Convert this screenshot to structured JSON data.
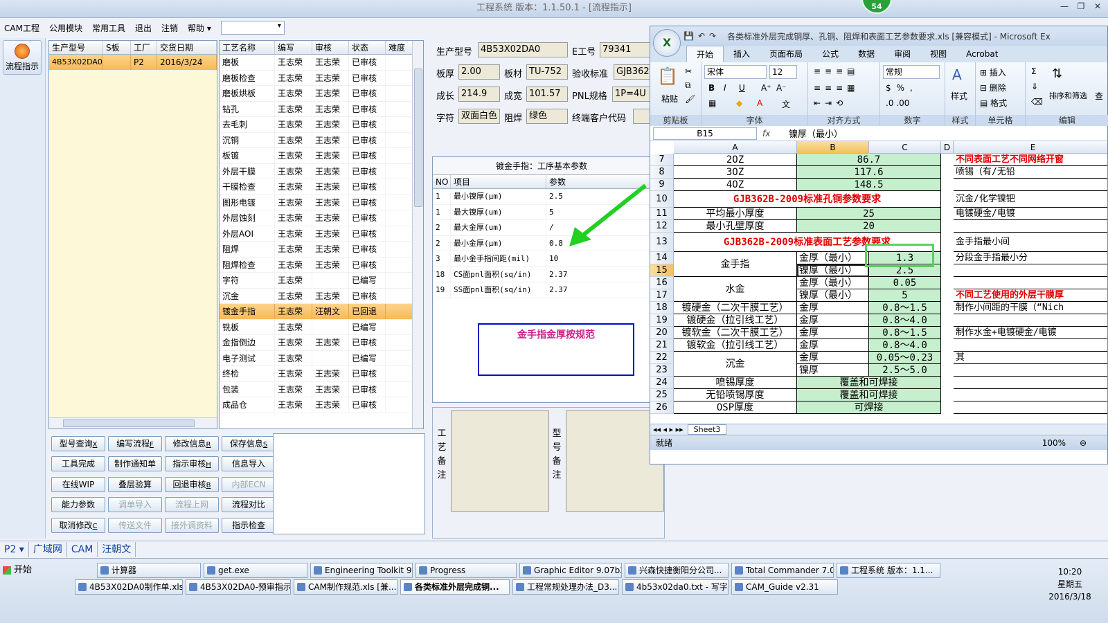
{
  "app": {
    "title": "工程系统  版本：1.1.50.1 - [流程指示]",
    "badge": "54"
  },
  "menu": [
    "CAM工程",
    "公用模块",
    "常用工具",
    "退出",
    "注销",
    "帮助"
  ],
  "nav": {
    "flow_label": "流程指示"
  },
  "product_grid": {
    "headers": [
      "生产型号",
      "S板",
      "工厂",
      "交货日期"
    ],
    "rows": [
      [
        "4B53X02DA0",
        "",
        "P2",
        "2016/3/24"
      ]
    ]
  },
  "process_grid": {
    "headers": [
      "工艺名称",
      "编写",
      "审核",
      "状态",
      "难度"
    ],
    "rows": [
      [
        "磨板",
        "王志荣",
        "王志荣",
        "已审核"
      ],
      [
        "磨板检查",
        "王志荣",
        "王志荣",
        "已审核"
      ],
      [
        "磨板烘板",
        "王志荣",
        "王志荣",
        "已审核"
      ],
      [
        "钻孔",
        "王志荣",
        "王志荣",
        "已审核"
      ],
      [
        "去毛刺",
        "王志荣",
        "王志荣",
        "已审核"
      ],
      [
        "沉铜",
        "王志荣",
        "王志荣",
        "已审核"
      ],
      [
        "板镀",
        "王志荣",
        "王志荣",
        "已审核"
      ],
      [
        "外层干膜",
        "王志荣",
        "王志荣",
        "已审核"
      ],
      [
        "干膜检查",
        "王志荣",
        "王志荣",
        "已审核"
      ],
      [
        "图形电镀",
        "王志荣",
        "王志荣",
        "已审核"
      ],
      [
        "外层蚀刻",
        "王志荣",
        "王志荣",
        "已审核"
      ],
      [
        "外层AOI",
        "王志荣",
        "王志荣",
        "已审核"
      ],
      [
        "阻焊",
        "王志荣",
        "王志荣",
        "已审核"
      ],
      [
        "阻焊检查",
        "王志荣",
        "王志荣",
        "已审核"
      ],
      [
        "字符",
        "王志荣",
        "",
        "已编写"
      ],
      [
        "沉金",
        "王志荣",
        "王志荣",
        "已审核"
      ],
      [
        "镀金手指",
        "王志荣",
        "汪朝文",
        "已回退"
      ],
      [
        "铣板",
        "王志荣",
        "",
        "已编写"
      ],
      [
        "金指倒边",
        "王志荣",
        "王志荣",
        "已审核"
      ],
      [
        "电子测试",
        "王志荣",
        "",
        "已编写"
      ],
      [
        "终检",
        "王志荣",
        "王志荣",
        "已审核"
      ],
      [
        "包装",
        "王志荣",
        "王志荣",
        "已审核"
      ],
      [
        "成品仓",
        "王志荣",
        "王志荣",
        "已审核"
      ]
    ],
    "selected_index": 16
  },
  "buttons": [
    {
      "label": "型号查询",
      "key": "X",
      "enabled": true
    },
    {
      "label": "编写流程",
      "key": "F",
      "enabled": true
    },
    {
      "label": "修改信息",
      "key": "R",
      "enabled": true
    },
    {
      "label": "保存信息",
      "key": "S",
      "enabled": true
    },
    {
      "label": "工具完成",
      "key": "",
      "enabled": true
    },
    {
      "label": "制作通知单",
      "key": "",
      "enabled": true
    },
    {
      "label": "指示审核",
      "key": "H",
      "enabled": true
    },
    {
      "label": "信息导入",
      "key": "",
      "enabled": true
    },
    {
      "label": "在线WIP",
      "key": "",
      "enabled": true
    },
    {
      "label": "叠层验算",
      "key": "",
      "enabled": true
    },
    {
      "label": "回退审核",
      "key": "B",
      "enabled": true
    },
    {
      "label": "内部ECN",
      "key": "",
      "enabled": false
    },
    {
      "label": "能力参数",
      "key": "",
      "enabled": true
    },
    {
      "label": "调单导入",
      "key": "",
      "enabled": false
    },
    {
      "label": "流程上网",
      "key": "",
      "enabled": false
    },
    {
      "label": "流程对比",
      "key": "",
      "enabled": true
    },
    {
      "label": "取消修改",
      "key": "C",
      "enabled": true
    },
    {
      "label": "传送文件",
      "key": "",
      "enabled": false
    },
    {
      "label": "接外调资料",
      "key": "",
      "enabled": false
    },
    {
      "label": "指示检查",
      "key": "",
      "enabled": true
    }
  ],
  "info": {
    "model_label": "生产型号",
    "model": "4B53X02DA0",
    "e_label": "E工号",
    "e_no": "79341",
    "thick_label": "板厚",
    "thick": "2.00",
    "mat_label": "板材",
    "mat": "TU-752",
    "std_label": "验收标准",
    "std": "GJB362",
    "len_label": "成长",
    "len": "214.9",
    "wid_label": "成宽",
    "wid": "101.57",
    "pnl_label": "PNL规格",
    "pnl": "1P=4U",
    "char_label": "字符",
    "char": "双面白色",
    "mask_label": "阻焊",
    "mask": "绿色",
    "cust_label": "终端客户代码"
  },
  "params": {
    "title": "镀金手指：工序基本参数",
    "headers": [
      "NO",
      "项目",
      "参数"
    ],
    "rows": [
      [
        "1",
        "最小镍厚(μm)",
        "2.5"
      ],
      [
        "1",
        "最大镍厚(um)",
        "5"
      ],
      [
        "2",
        "最大金厚(um)",
        "/"
      ],
      [
        "2",
        "最小金厚(μm)",
        "0.8"
      ],
      [
        "3",
        "最小金手指间距(mil)",
        "10"
      ],
      [
        "18",
        "CS面pnl面积(sq/in)",
        "2.37"
      ],
      [
        "19",
        "SS面pnl面积(sq/in)",
        "2.37"
      ]
    ]
  },
  "note_box": "金手指金厚按规范",
  "remarks": {
    "process": "工艺备注",
    "model": "型号备注"
  },
  "excel": {
    "title": "各类标准外层完成铜厚、孔铜、阻焊和表面工艺参数要求.xls [兼容模式] - Microsoft Ex",
    "tabs": [
      "开始",
      "插入",
      "页面布局",
      "公式",
      "数据",
      "审阅",
      "视图",
      "Acrobat"
    ],
    "groups": [
      "剪贴板",
      "字体",
      "对齐方式",
      "数字",
      "样式",
      "单元格",
      "编辑"
    ],
    "font": "宋体",
    "size": "12",
    "numfmt": "常规",
    "paste": "粘贴",
    "style": "样式",
    "insert": "插入",
    "delete": "删除",
    "format": "格式",
    "sort": "排序和筛选",
    "find": "查",
    "namebox": "B15",
    "formula": "镍厚（最小）",
    "cols": [
      "A",
      "B",
      "C",
      "D",
      "E"
    ],
    "rows": [
      {
        "n": "7",
        "a": "2OZ",
        "b": "86.7",
        "e": "不同表面工艺不同网络开窗"
      },
      {
        "n": "8",
        "a": "3OZ",
        "b": "117.6",
        "e": "喷锡（有/无铅"
      },
      {
        "n": "9",
        "a": "4OZ",
        "b": "148.5",
        "e": ""
      },
      {
        "n": "10",
        "title": "GJB362B-2009标准孔铜参数要求",
        "e": "沉金/化学镍钯"
      },
      {
        "n": "11",
        "a": "平均最小厚度",
        "b": "25",
        "e": "电镀硬金/电镀"
      },
      {
        "n": "12",
        "a": "最小孔壁厚度",
        "b": "20",
        "e": ""
      },
      {
        "n": "13",
        "title": "GJB362B-2009标准表面工艺参数要求",
        "e": "金手指最小间"
      },
      {
        "n": "14",
        "b": "金厚（最小）",
        "c": "1.3",
        "e": "分段金手指最小分"
      },
      {
        "n": "15",
        "b": "镍厚（最小）",
        "c": "2.5",
        "e": ""
      },
      {
        "n": "16",
        "b": "金厚（最小）",
        "c": "0.05",
        "e": ""
      },
      {
        "n": "17",
        "b": "镍厚（最小）",
        "c": "5",
        "e": "不同工艺使用的外层干膜厚"
      },
      {
        "n": "18",
        "a": "镀硬金（二次干膜工艺）",
        "b": "金厚",
        "c": "0.8～1.5",
        "e": "制作小间距的干膜（“Nich"
      },
      {
        "n": "19",
        "a": "镀硬金（拉引线工艺）",
        "b": "金厚",
        "c": "0.8～4.0",
        "e": ""
      },
      {
        "n": "20",
        "a": "镀软金（二次干膜工艺）",
        "b": "金厚",
        "c": "0.8～1.5",
        "e": "制作水金+电镀硬金/电镀"
      },
      {
        "n": "21",
        "a": "镀软金（拉引线工艺）",
        "b": "金厚",
        "c": "0.8～4.0",
        "e": ""
      },
      {
        "n": "22",
        "b": "金厚",
        "c": "0.05～0.23",
        "e": "其"
      },
      {
        "n": "23",
        "b": "镍厚",
        "c": "2.5～5.0",
        "e": ""
      },
      {
        "n": "24",
        "a": "喷锡厚度",
        "bc": "覆盖和可焊接",
        "e": ""
      },
      {
        "n": "25",
        "a": "无铅喷锡厚度",
        "bc": "覆盖和可焊接",
        "e": ""
      },
      {
        "n": "26",
        "a": "OSP厚度",
        "bc": "可焊接",
        "e": ""
      }
    ],
    "merged": {
      "gold_finger": "金手指",
      "water_gold": "水金",
      "immersion_gold": "沉金"
    },
    "sheet_tab": "Sheet3",
    "status": "就绪",
    "zoom": "100%"
  },
  "bottom": [
    "P2",
    "广域网",
    "CAM",
    "汪朝文"
  ],
  "taskbar": {
    "start": "开始",
    "row1": [
      "计算器",
      "get.exe",
      "Engineering Toolkit 9.0...",
      "Progress",
      "Graphic Editor 9.07b2 (...",
      "兴森快捷衡阳分公司...",
      "Total Commander 7.0 p...",
      "工程系统  版本：1.1..."
    ],
    "row2": [
      "4B53X02DA0制作单.xls ...",
      "4B53X02DA0-预审指示...",
      "CAM制作规范.xls [兼...",
      "各类标准外层完成铜...",
      "工程常规处理办法_D3...",
      "4b53x02da0.txt - 写字板",
      "CAM_Guide v2.31"
    ],
    "time": "10:20",
    "weekday": "星期五",
    "date": "2016/3/18"
  }
}
